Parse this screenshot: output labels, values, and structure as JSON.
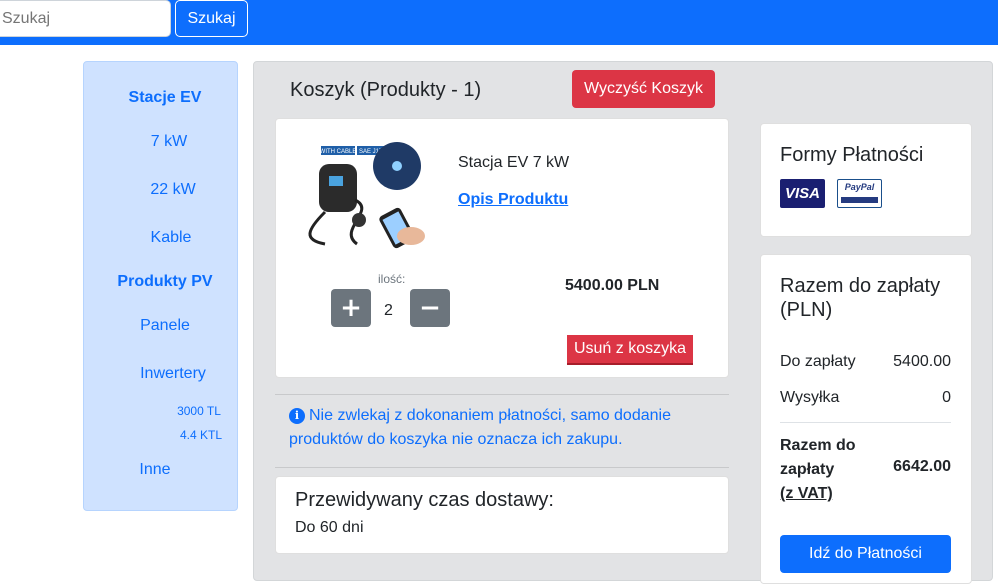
{
  "header": {
    "search_placeholder": "Szukaj",
    "search_button": "Szukaj"
  },
  "sidebar": {
    "items": [
      {
        "label": "Stacje EV"
      },
      {
        "label": "7 kW"
      },
      {
        "label": "22 kW"
      },
      {
        "label": "Kable"
      },
      {
        "label": "Produkty PV"
      },
      {
        "label": "Panele"
      },
      {
        "label": "Inwertery"
      },
      {
        "label": "3000 TL"
      },
      {
        "label": "4.4 KTL"
      },
      {
        "label": "Inne"
      }
    ]
  },
  "cart": {
    "title": "Koszyk (Produkty - 1)",
    "clear_button": "Wyczyść Koszyk",
    "product": {
      "image_label_1": "WITH CABLE",
      "image_label_2": "SAE J1772",
      "name": "Stacja EV 7 kW",
      "description_link": "Opis Produktu",
      "quantity_label": "ilość:",
      "quantity": "2",
      "plus": "+",
      "minus": "−",
      "price": "5400.00 PLN",
      "remove_button": "Usuń z koszyka"
    },
    "info_icon": "i",
    "info_text": "Nie zwlekaj z dokonaniem płatności, samo dodanie produktów do koszyka nie oznacza ich zakupu.",
    "delivery": {
      "title": "Przewidywany czas dostawy:",
      "value": "Do 60 dni"
    }
  },
  "payment": {
    "title": "Formy Płatności",
    "visa": "VISA",
    "paypal": "PayPal"
  },
  "summary": {
    "title": "Razem do zapłaty (PLN)",
    "rows": [
      {
        "label": "Do zapłaty",
        "value": "5400.00"
      },
      {
        "label": "Wysyłka",
        "value": "0"
      }
    ],
    "grand_label_1": "Razem do",
    "grand_label_2": "zapłaty",
    "grand_label_3": "(z VAT)",
    "grand_value": "6642.00",
    "checkout_button": "Idź do Płatności"
  },
  "colors": {
    "primary": "#0d6efd",
    "danger": "#dc3545",
    "secondary": "#6c757d",
    "sidebar_bg": "#cfe2ff",
    "main_bg": "#e2e3e5"
  }
}
